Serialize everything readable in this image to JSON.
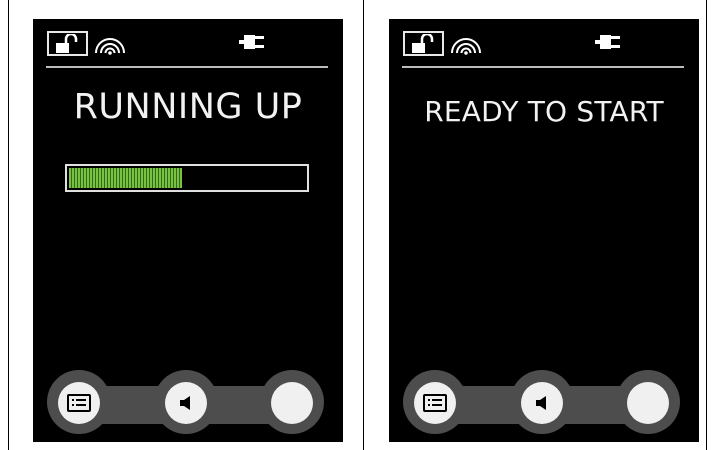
{
  "screens": [
    {
      "state_title": "RUNNING UP",
      "progress": 0.48,
      "status_icons": [
        "unlocked-padlock-icon",
        "wireless-signal-icon",
        "power-plug-icon"
      ],
      "controls": [
        "menu-list-icon",
        "speaker-icon",
        "blank-button"
      ]
    },
    {
      "state_title": "READY TO START",
      "status_icons": [
        "unlocked-padlock-icon",
        "wireless-signal-icon",
        "power-plug-icon"
      ],
      "controls": [
        "menu-list-icon",
        "speaker-icon",
        "blank-button"
      ]
    }
  ],
  "colors": {
    "screen_background": "#000000",
    "text": "#f2f2f2",
    "progress_fill": "#79c043",
    "control_track": "#4d4d4d",
    "button_face": "#f0f0f0"
  }
}
